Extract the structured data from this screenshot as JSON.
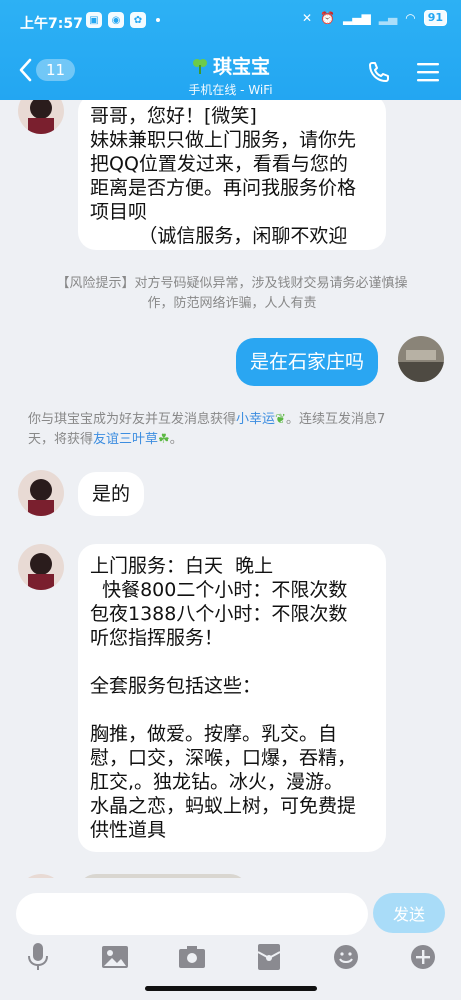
{
  "status_bar": {
    "time": "上午7:57",
    "battery": "91"
  },
  "header": {
    "back_count": "11",
    "title": "琪宝宝",
    "subtitle": "手机在线 - WiFi"
  },
  "messages": {
    "m1": "哥哥，您好！[微笑]\n妹妹兼职只做上门服务，请你先\n把QQ位置发过来，看看与您的\n距离是否方便。再问我服务价格\n项目呗\n        （诚信服务，闲聊不欢迎",
    "risk_tip": "【风险提示】对方号码疑似异常，涉及钱财交易请务必谨慎操\n作，防范网络诈骗，人人有责",
    "m2": "是在石家庄吗",
    "friend_tip_a": "你与琪宝宝成为好友并互发消息获得",
    "friend_tip_link1": "小幸运",
    "friend_tip_b": "。连续互发消息7\n天，将获得",
    "friend_tip_link2": "友谊三叶草",
    "friend_tip_c": "。",
    "m3": "是的",
    "m4": "上门服务：白天  晚上\n  快餐800二个小时：不限次数\n包夜1388八个小时：不限次数\n听您指挥服务！\n\n全套服务包括这些：\n\n胸推，做爱。按摩。乳交。自\n慰，口交，深喉，口爆，吞精，\n肛交,。独龙钻。冰火，漫游。\n水晶之恋，蚂蚁上树，可免费提\n供性道具"
  },
  "input": {
    "placeholder": "",
    "send_label": "发送"
  },
  "colors": {
    "accent": "#23a6f2",
    "my_bubble": "#2aa6f2",
    "background": "#eef0f4"
  }
}
